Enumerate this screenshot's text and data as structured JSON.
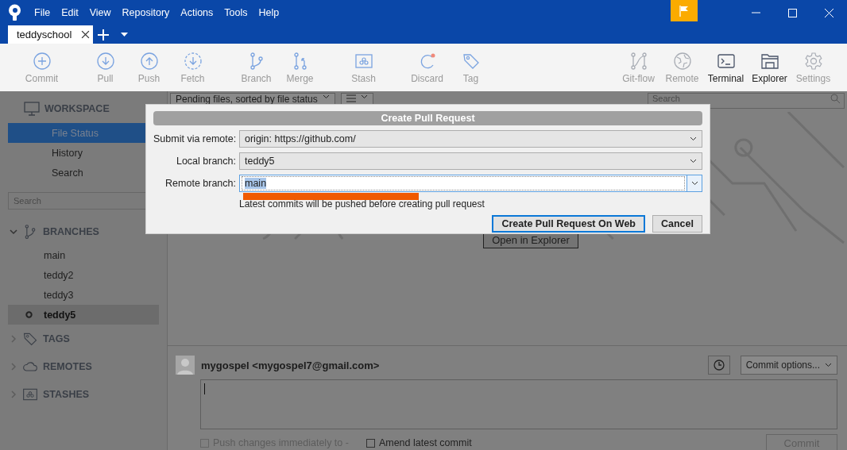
{
  "window": {
    "menu": [
      "File",
      "Edit",
      "View",
      "Repository",
      "Actions",
      "Tools",
      "Help"
    ]
  },
  "tabs": [
    {
      "label": "teddyschool",
      "selected": true
    }
  ],
  "toolbar": {
    "left_groups": [
      [
        {
          "label": "Commit",
          "disabled": true
        }
      ],
      [
        {
          "label": "Pull",
          "disabled": true
        },
        {
          "label": "Push",
          "disabled": true
        },
        {
          "label": "Fetch",
          "disabled": true
        }
      ],
      [
        {
          "label": "Branch",
          "disabled": true
        },
        {
          "label": "Merge",
          "disabled": true
        }
      ],
      [
        {
          "label": "Stash",
          "disabled": true
        }
      ],
      [
        {
          "label": "Discard",
          "disabled": true
        },
        {
          "label": "Tag",
          "disabled": true
        }
      ]
    ],
    "right_items": [
      {
        "label": "Git-flow",
        "disabled": true
      },
      {
        "label": "Remote",
        "disabled": true
      },
      {
        "label": "Terminal",
        "disabled": false
      },
      {
        "label": "Explorer",
        "disabled": false
      },
      {
        "label": "Settings",
        "disabled": true
      }
    ]
  },
  "sidebar": {
    "workspace": {
      "title": "WORKSPACE",
      "items": [
        {
          "label": "File Status",
          "selected": true
        },
        {
          "label": "History",
          "selected": false
        },
        {
          "label": "Search",
          "selected": false
        }
      ]
    },
    "search": {
      "placeholder": "Search"
    },
    "sections": [
      {
        "title": "BRANCHES",
        "expanded": true,
        "items": [
          {
            "label": "main",
            "current": false
          },
          {
            "label": "teddy2",
            "current": false
          },
          {
            "label": "teddy3",
            "current": false
          },
          {
            "label": "teddy5",
            "current": true
          }
        ]
      },
      {
        "title": "TAGS",
        "expanded": false
      },
      {
        "title": "REMOTES",
        "expanded": false
      },
      {
        "title": "STASHES",
        "expanded": false
      }
    ]
  },
  "content": {
    "filter": "Pending files, sorted by file status",
    "search": {
      "placeholder": "Search"
    },
    "open_button": "Open in Explorer",
    "commit": {
      "author": "mygospel <mygospel7@gmail.com>",
      "options": "Commit options...",
      "push_option": {
        "label": "Push changes immediately to -",
        "checked": false,
        "disabled": true
      },
      "amend_option": {
        "label": "Amend latest commit",
        "checked": false,
        "disabled": false
      },
      "commit_button": {
        "label": "Commit",
        "disabled": true
      }
    }
  },
  "dialog": {
    "title": "Create Pull Request",
    "fields": [
      {
        "label": "Submit via remote:",
        "kind": "dropdown",
        "value": "origin: https://github.com/"
      },
      {
        "label": "Local branch:",
        "kind": "dropdown",
        "value": "teddy5"
      },
      {
        "label": "Remote branch:",
        "kind": "combo",
        "value": "main",
        "text_selected": true
      }
    ],
    "hint": "Latest commits will be pushed before creating pull request",
    "buttons": [
      {
        "label": "Create Pull Request On Web",
        "default": true
      },
      {
        "label": "Cancel",
        "default": false
      }
    ]
  }
}
